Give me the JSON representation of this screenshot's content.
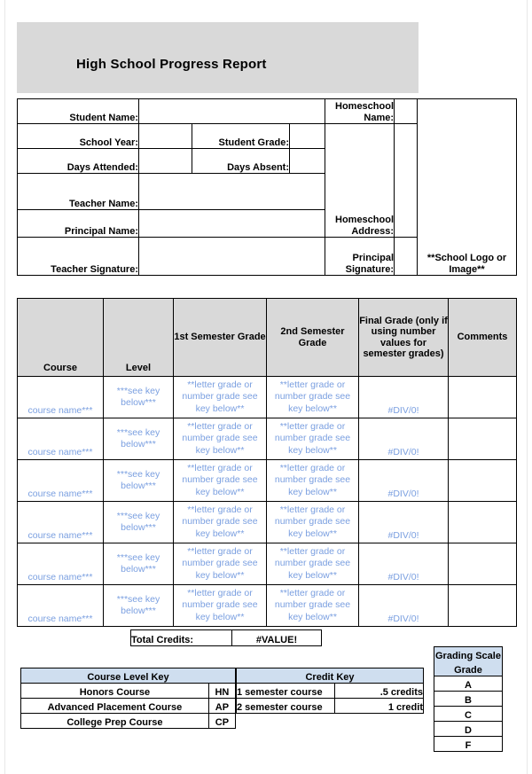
{
  "document": {
    "title": "High School Progress Report"
  },
  "info": {
    "labels": {
      "student_name": "Student Name:",
      "school_year": "School Year:",
      "days_attended": "Days Attended:",
      "teacher_name": "Teacher Name:",
      "principal_name": "Principal Name:",
      "teacher_signature": "Teacher Signature:",
      "student_grade": "Student Grade:",
      "days_absent": "Days Absent:",
      "homeschool_name": "Homeschool Name:",
      "homeschool_address": "Homeschool Address:",
      "principal_signature": "Principal Signature:"
    },
    "values": {
      "student_name": "",
      "school_year": "",
      "days_attended": "",
      "teacher_name": "",
      "principal_name": "",
      "teacher_signature": "",
      "student_grade": "",
      "days_absent": "",
      "homeschool_name": "",
      "homeschool_address": "",
      "principal_signature": ""
    },
    "logo_placeholder": "**School Logo or Image**"
  },
  "grades": {
    "headers": {
      "course": "Course",
      "level": "Level",
      "sem1": "1st Semester Grade",
      "sem2": "2nd Semester Grade",
      "final": "Final Grade (only if using number values for semester grades)",
      "comments": "Comments"
    },
    "placeholders": {
      "course": "course name***",
      "level": "***see key below***",
      "semester": "**letter grade or number grade see key below**",
      "final": "#DIV/0!",
      "comments": ""
    },
    "rows": [
      {
        "course": "course name***",
        "level": "***see key below***",
        "sem1": "**letter grade or number grade see key below**",
        "sem2": "**letter grade or number grade see key below**",
        "final": "#DIV/0!",
        "comments": ""
      },
      {
        "course": "course name***",
        "level": "***see key below***",
        "sem1": "**letter grade or number grade see key below**",
        "sem2": "**letter grade or number grade see key below**",
        "final": "#DIV/0!",
        "comments": ""
      },
      {
        "course": "course name***",
        "level": "***see key below***",
        "sem1": "**letter grade or number grade see key below**",
        "sem2": "**letter grade or number grade see key below**",
        "final": "#DIV/0!",
        "comments": ""
      },
      {
        "course": "course name***",
        "level": "***see key below***",
        "sem1": "**letter grade or number grade see key below**",
        "sem2": "**letter grade or number grade see key below**",
        "final": "#DIV/0!",
        "comments": ""
      },
      {
        "course": "course name***",
        "level": "***see key below***",
        "sem1": "**letter grade or number grade see key below**",
        "sem2": "**letter grade or number grade see key below**",
        "final": "#DIV/0!",
        "comments": ""
      },
      {
        "course": "course name***",
        "level": "***see key below***",
        "sem1": "**letter grade or number grade see key below**",
        "sem2": "**letter grade or number grade see key below**",
        "final": "#DIV/0!",
        "comments": ""
      }
    ]
  },
  "total_credits": {
    "label": "Total Credits:",
    "value": "#VALUE!"
  },
  "course_level_key": {
    "title": "Course Level Key",
    "rows": [
      {
        "name": "Honors Course",
        "code": "HN"
      },
      {
        "name": "Advanced Placement Course",
        "code": "AP"
      },
      {
        "name": "College Prep Course",
        "code": "CP"
      }
    ]
  },
  "credit_key": {
    "title": "Credit Key",
    "rows": [
      {
        "name": "1 semester course",
        "value": ".5 credits"
      },
      {
        "name": "2 semester course",
        "value": "1 credit"
      }
    ]
  },
  "grading_scale": {
    "title": "Grading Scale",
    "column_header": "Grade",
    "grades": [
      "A",
      "B",
      "C",
      "D",
      "F"
    ]
  },
  "colors": {
    "banner_gray": "#d9d9d9",
    "header_gray": "#d9d9d9",
    "key_header_blue": "#cfdeef",
    "placeholder_blue": "#7a9fe0",
    "border": "#000000"
  }
}
